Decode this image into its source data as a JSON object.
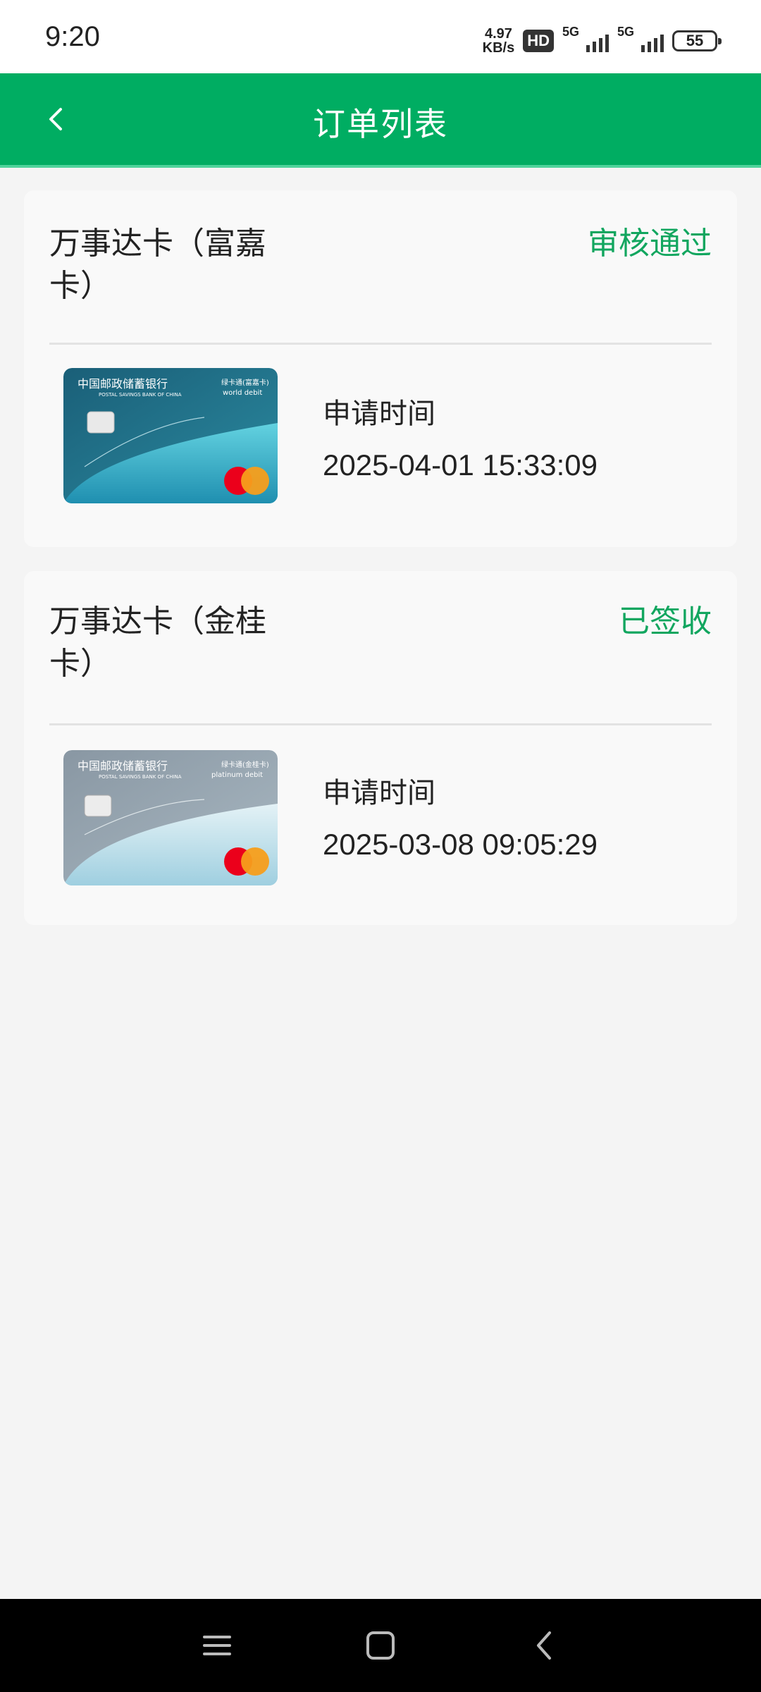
{
  "status_bar": {
    "time": "9:20",
    "net_speed_value": "4.97",
    "net_speed_unit": "KB/s",
    "hd_badge": "HD",
    "signal1_label": "5G",
    "signal2_label": "5G",
    "battery": "55"
  },
  "header": {
    "title": "订单列表",
    "back_icon": "chevron-left-icon"
  },
  "orders": [
    {
      "name": "万事达卡（富嘉卡）",
      "status": "审核通过",
      "apply_label": "申请时间",
      "apply_time": "2025-04-01 15:33:09",
      "card_bank_cn": "中国邮政储蓄银行",
      "card_bank_en": "POSTAL SAVINGS BANK OF CHINA",
      "card_series": "绿卡通(富嘉卡)",
      "card_type": "world debit",
      "card_colors": [
        "#1d6b86",
        "#4fb7c9"
      ]
    },
    {
      "name": "万事达卡（金桂卡）",
      "status": "已签收",
      "apply_label": "申请时间",
      "apply_time": "2025-03-08 09:05:29",
      "card_bank_cn": "中国邮政储蓄银行",
      "card_bank_en": "POSTAL SAVINGS BANK OF CHINA",
      "card_series": "绿卡通(金桂卡)",
      "card_type": "platinum debit",
      "card_colors": [
        "#8d9aa6",
        "#d6e8ef"
      ]
    }
  ],
  "colors": {
    "brand_green": "#00ad62",
    "status_green": "#12a65f"
  },
  "bottom_nav": {
    "icons": [
      "menu-icon",
      "home-icon",
      "back-icon"
    ]
  }
}
